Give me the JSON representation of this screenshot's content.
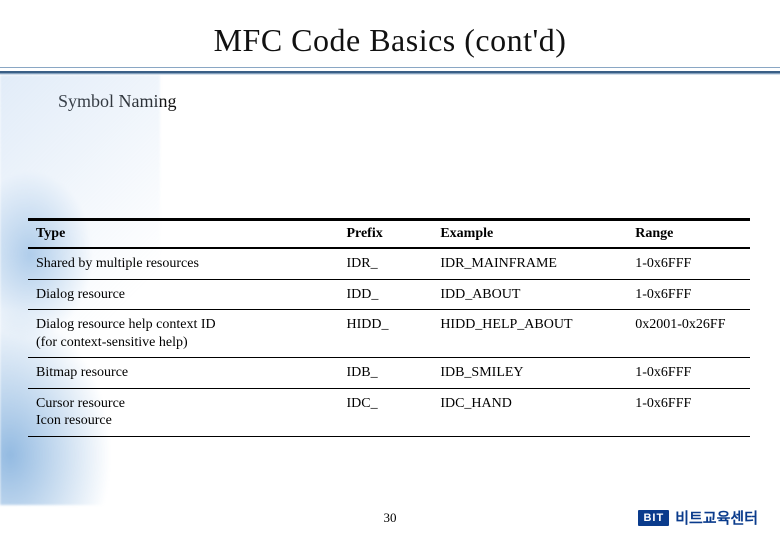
{
  "title": "MFC Code Basics (cont'd)",
  "section_heading": "Symbol Naming",
  "table": {
    "headers": [
      "Type",
      "Prefix",
      "Example",
      "Range"
    ],
    "rows": [
      {
        "type": "Shared by multiple resources",
        "prefix": "IDR_",
        "example": "IDR_MAINFRAME",
        "range": "1-0x6FFF"
      },
      {
        "type": "Dialog resource",
        "prefix": "IDD_",
        "example": "IDD_ABOUT",
        "range": "1-0x6FFF"
      },
      {
        "type": "Dialog resource help context ID\n(for context-sensitive help)",
        "prefix": "HIDD_",
        "example": "HIDD_HELP_ABOUT",
        "range": "0x2001-0x26FF"
      },
      {
        "type": "Bitmap resource",
        "prefix": "IDB_",
        "example": "IDB_SMILEY",
        "range": "1-0x6FFF"
      },
      {
        "type": "Cursor resource\nIcon resource",
        "prefix": "IDC_",
        "example": "IDC_HAND",
        "range": "1-0x6FFF"
      }
    ]
  },
  "page_number": "30",
  "footer": {
    "badge": "BIT",
    "text": "비트교육센터"
  }
}
